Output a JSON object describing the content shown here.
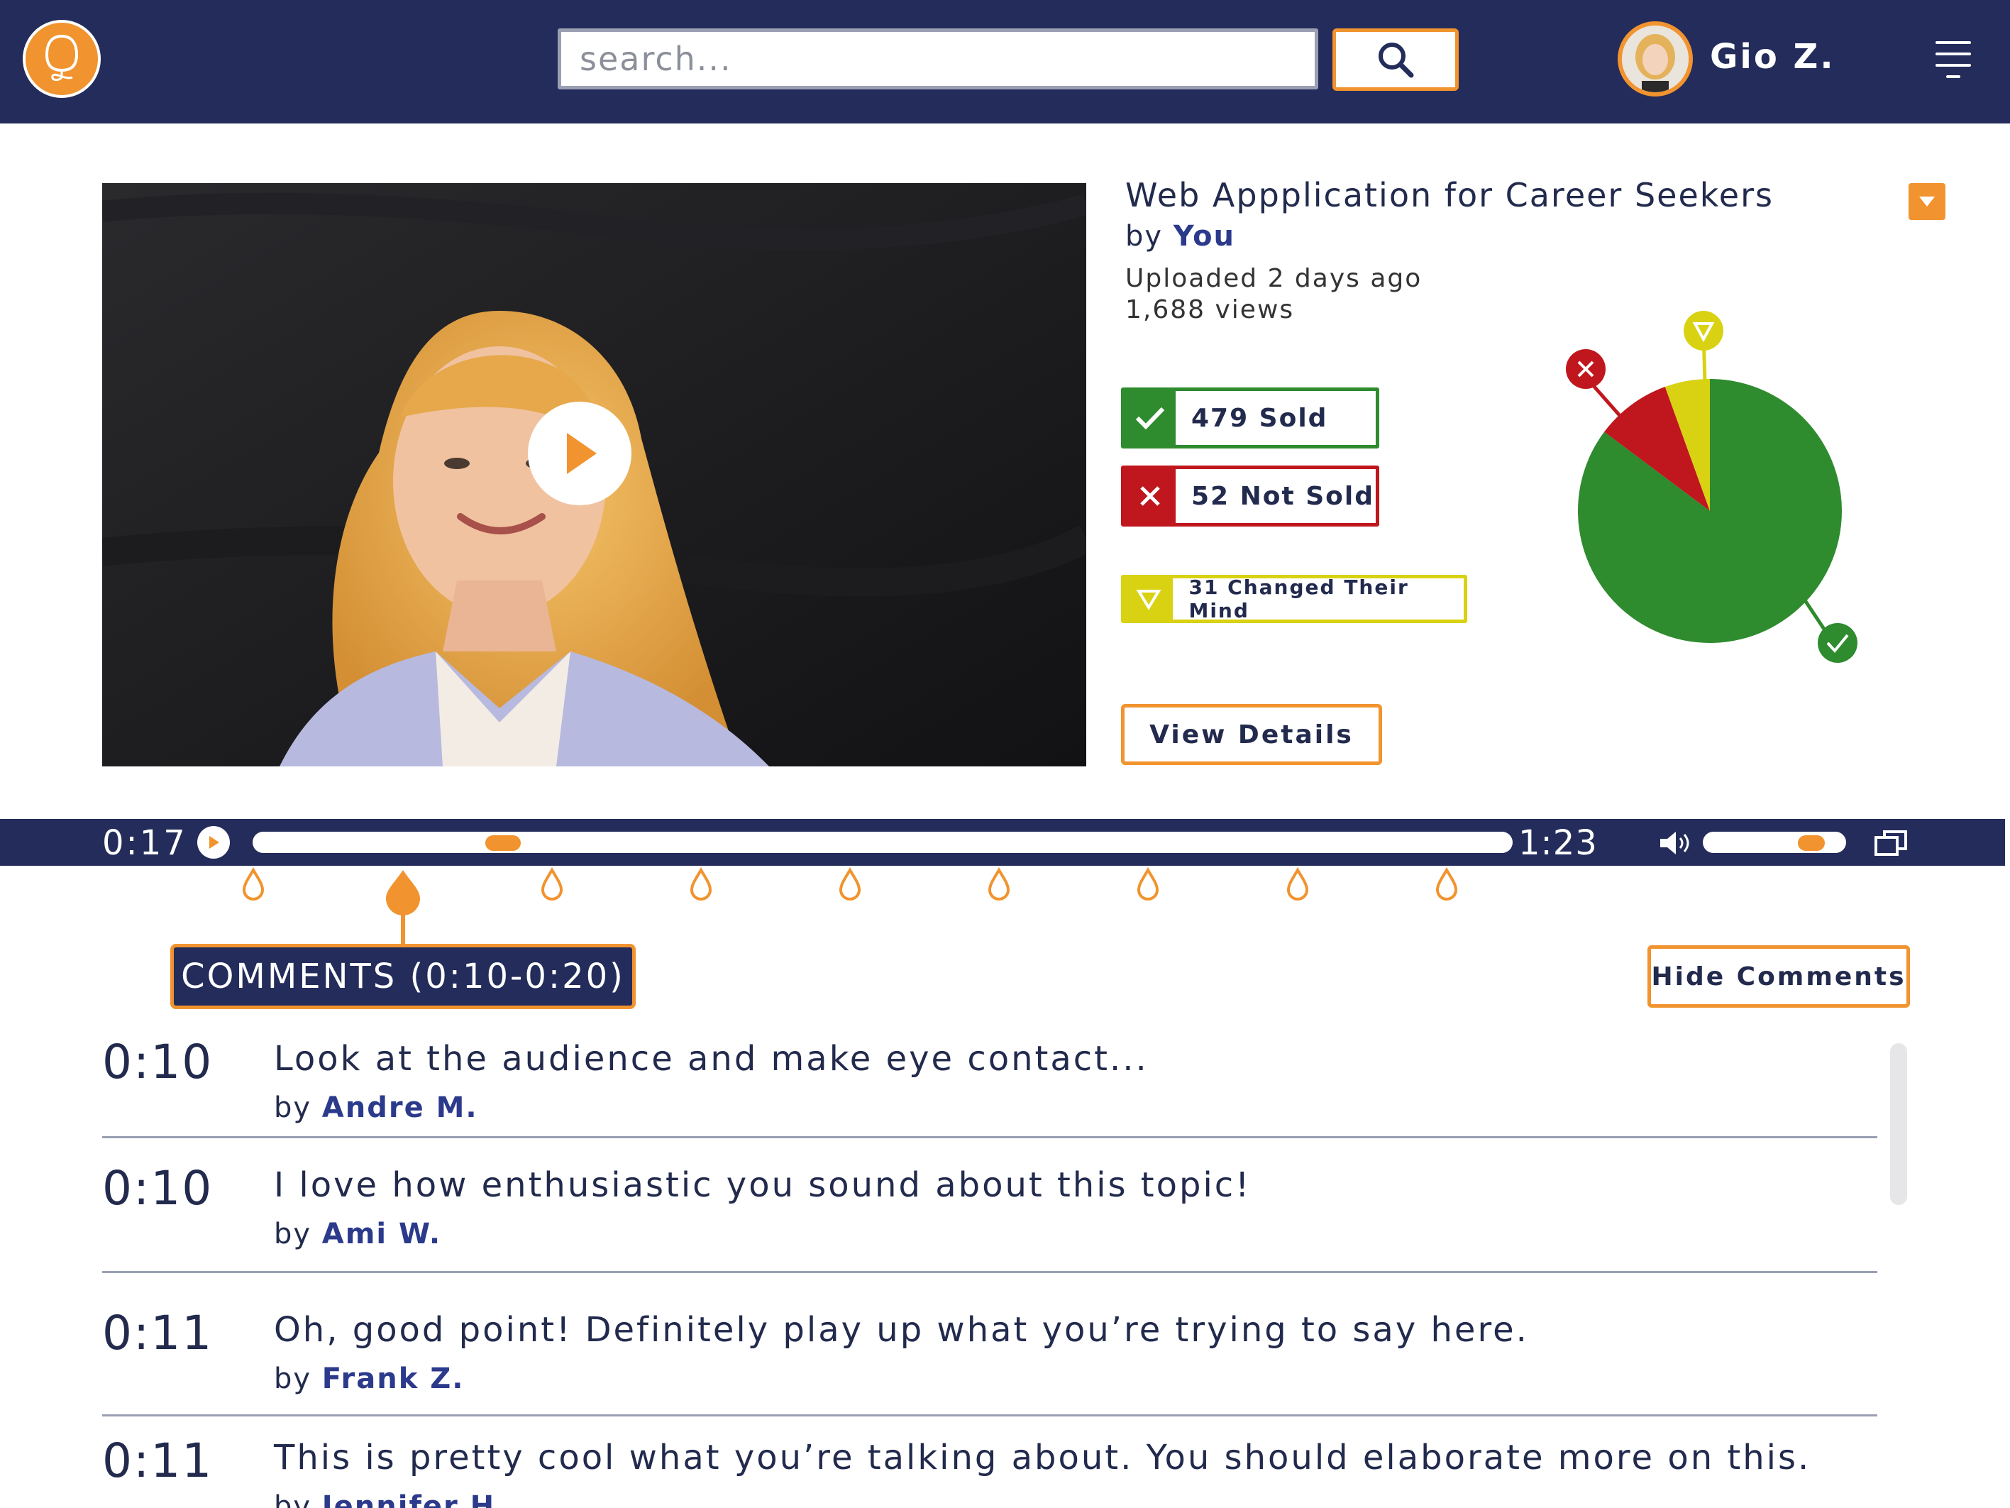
{
  "header": {
    "search_placeholder": "search...",
    "username": "Gio Z."
  },
  "video": {
    "title": "Web Appplication for Career Seekers",
    "by_prefix": "by",
    "author": "You",
    "uploaded": "Uploaded 2 days ago",
    "views": "1,688 views"
  },
  "stats": {
    "sold": "479 Sold",
    "not_sold": "52 Not Sold",
    "changed": "31 Changed Their Mind",
    "view_details": "View Details",
    "colors": {
      "sold": "#2e8b2e",
      "not_sold": "#c0161d",
      "changed": "#d8d213"
    }
  },
  "pie": {
    "values": {
      "sold": 479,
      "not_sold": 52,
      "changed": 31
    }
  },
  "player": {
    "current_time": "0:17",
    "total_time": "1:23",
    "progress": 0.19,
    "volume": 0.85
  },
  "comments_panel": {
    "tab_label": "COMMENTS (0:10-0:20)",
    "hide_label": "Hide Comments",
    "items": [
      {
        "time": "0:10",
        "text": "Look at the audience and make eye contact...",
        "by": "by",
        "author": "Andre M."
      },
      {
        "time": "0:10",
        "text": "I love how enthusiastic you sound about this topic!",
        "by": "by",
        "author": "Ami W."
      },
      {
        "time": "0:11",
        "text": "Oh, good point! Definitely play up what you’re trying to say here.",
        "by": "by",
        "author": "Frank Z."
      },
      {
        "time": "0:11",
        "text": "This is pretty cool what you’re talking about. You should elaborate more on this.",
        "by": "by",
        "author": "Jennifer H."
      }
    ]
  },
  "theme": {
    "navy": "#232c5a",
    "orange": "#f1932e"
  }
}
